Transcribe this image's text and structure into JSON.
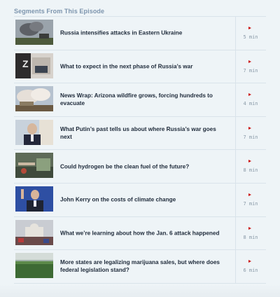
{
  "section": {
    "heading": "Segments From This Episode"
  },
  "segments": [
    {
      "title": "Russia intensifies attacks in Eastern Ukraine",
      "duration": "5 min",
      "thumb_icon": "smoke-battlefield-image"
    },
    {
      "title": "What to expect in the next phase of Russia’s war",
      "duration": "7 min",
      "thumb_icon": "z-symbol-image"
    },
    {
      "title": "News Wrap: Arizona wildfire grows, forcing hundreds to evacuate",
      "duration": "4 min",
      "thumb_icon": "wildfire-smoke-image"
    },
    {
      "title": "What Putin’s past tells us about where Russia’s war goes next",
      "duration": "7 min",
      "thumb_icon": "putin-portrait-image"
    },
    {
      "title": "Could hydrogen be the clean fuel of the future?",
      "duration": "8 min",
      "thumb_icon": "hydrogen-equipment-image"
    },
    {
      "title": "John Kerry on the costs of climate change",
      "duration": "7 min",
      "thumb_icon": "kerry-portrait-image"
    },
    {
      "title": "What we’re learning about how the Jan. 6 attack happened",
      "duration": "8 min",
      "thumb_icon": "capitol-crowd-image"
    },
    {
      "title": "More states are legalizing marijuana sales, but where does federal legislation stand?",
      "duration": "6 min",
      "thumb_icon": "greenhouse-plants-image"
    }
  ],
  "colors": {
    "play": "#cc1111",
    "title": "#1e2a3a",
    "heading": "#7d95ae"
  }
}
